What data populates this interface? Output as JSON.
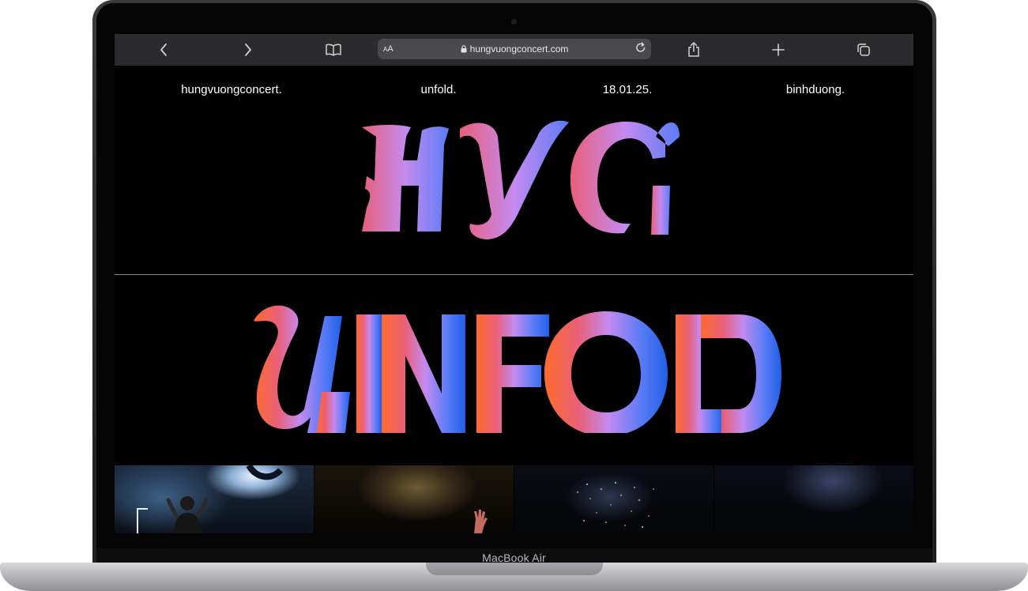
{
  "device": {
    "label": "MacBook Air"
  },
  "browser": {
    "url": "hungvuongconcert.com",
    "text_size_label": "AA"
  },
  "nav": {
    "items": [
      "hungvuongconcert.",
      "unfold.",
      "18.01.25.",
      "binhduong."
    ]
  },
  "hero": {
    "logo_text": "HVC",
    "title": "UNFOLD"
  },
  "gallery": {
    "images": [
      "singer-on-stage-photo",
      "stage-smoke-hand-photo",
      "crowd-confetti-photo",
      "dark-stage-photo"
    ]
  },
  "colors": {
    "gradient_start": "#ff6a2b",
    "gradient_mid1": "#e8607a",
    "gradient_mid2": "#c48af0",
    "gradient_mid3": "#5b7cf7",
    "gradient_end": "#1f5fe6",
    "toolbar_bg": "#2b2b2d",
    "page_bg": "#000000"
  }
}
